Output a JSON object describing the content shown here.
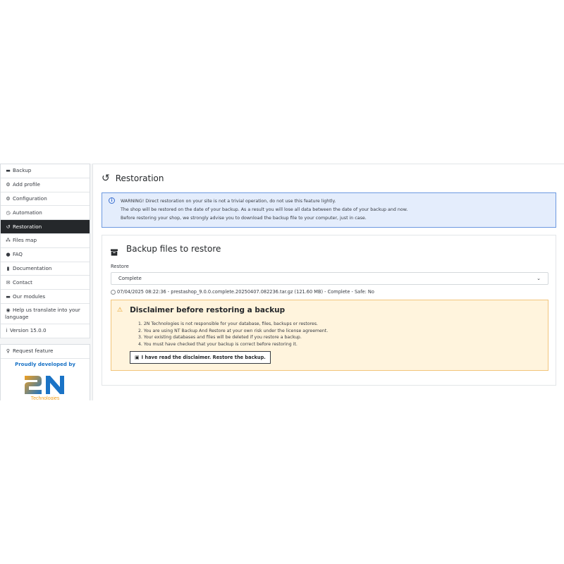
{
  "sidebar": {
    "items": [
      {
        "label": "Backup",
        "icon": "archive-icon",
        "glyph": "▬"
      },
      {
        "label": "Add profile",
        "icon": "cogs-icon",
        "glyph": "⚙"
      },
      {
        "label": "Configuration",
        "icon": "cogs-icon",
        "glyph": "⚙"
      },
      {
        "label": "Automation",
        "icon": "clock-icon",
        "glyph": "◷"
      },
      {
        "label": "Restoration",
        "icon": "history-icon",
        "glyph": "↺"
      },
      {
        "label": "Files map",
        "icon": "sitemap-icon",
        "glyph": "⁂"
      },
      {
        "label": "FAQ",
        "icon": "question-circle-icon",
        "glyph": "●"
      },
      {
        "label": "Documentation",
        "icon": "book-icon",
        "glyph": "▮"
      },
      {
        "label": "Contact",
        "icon": "envelope-icon",
        "glyph": "✉"
      },
      {
        "label": "Our modules",
        "icon": "archive-icon",
        "glyph": "▬"
      },
      {
        "label": "Help us translate into your language",
        "icon": "globe-icon",
        "glyph": "◉"
      },
      {
        "label": "Version 15.0.0",
        "icon": "info-icon",
        "glyph": "i"
      }
    ],
    "active_index": 4,
    "request_feature": {
      "label": "Request feature",
      "glyph": "♀"
    },
    "developed_by": "Proudly developed by",
    "logo_text": "2N",
    "logo_subtext": "Technologies"
  },
  "main": {
    "title": "Restoration",
    "warning": {
      "line1": "WARNING! Direct restoration on your site is not a trivial operation, do not use this feature lightly.",
      "line2": "The shop will be restored on the date of your backup. As a result you will lose all data between the date of your backup and now.",
      "line3": "Before restoring your shop, we strongly advise you to download the backup file to your computer, just in case."
    },
    "card": {
      "title": "Backup files to restore",
      "restore_label": "Restore",
      "restore_selected": "Complete",
      "backup_file": "07/04/2025 08:22:36 - prestashop_9.0.0.complete.20250407.082236.tar.gz (121.60 MB) - Complete - Safe: No",
      "disclaimer": {
        "title": "Disclaimer before restoring a backup",
        "items": [
          "1. 2N Technologies is not responsible for your database, files, backups or restores.",
          "2. You are using NT Backup And Restore at your own risk under the license agreement.",
          "3. Your existing databases and files will be deleted if you restore a backup.",
          "4. You must have checked that your backup is correct before restoring it."
        ],
        "button_label": "I have read the disclaimer. Restore the backup."
      }
    }
  },
  "colors": {
    "active_bg": "#25282b",
    "info_bg": "#e4edfc",
    "info_border": "#6c99e0",
    "warning_bg": "#fff4dd",
    "warning_border": "#f2c57b",
    "brand_blue": "#1a73c6",
    "brand_orange": "#f0a020"
  }
}
